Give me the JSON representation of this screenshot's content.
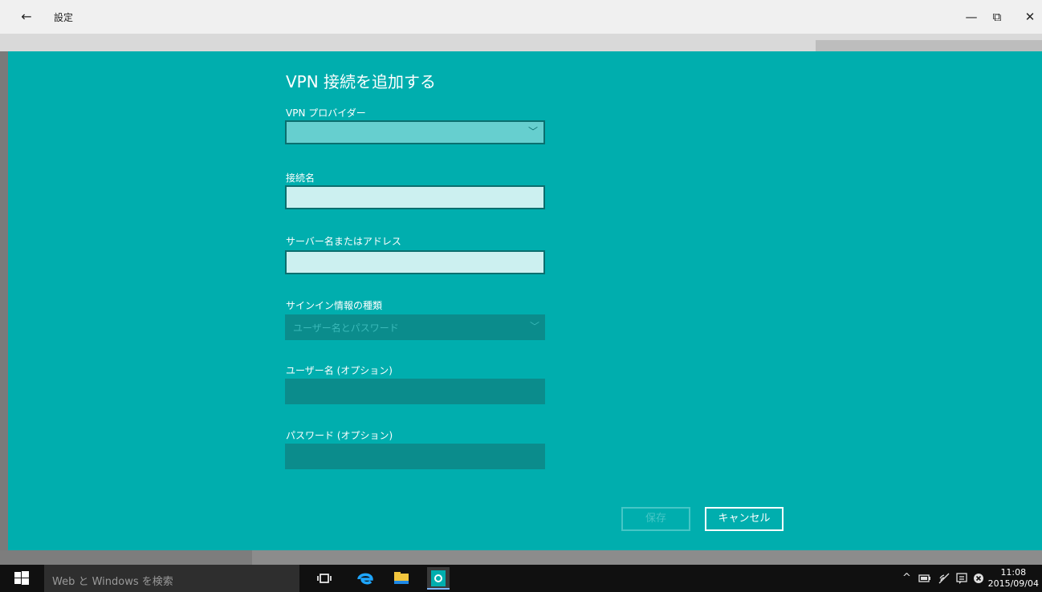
{
  "window": {
    "title": "設定",
    "back_icon": "←",
    "minimize_icon": "—",
    "restore_icon": "⧉",
    "close_icon": "✕"
  },
  "dialog": {
    "title": "VPN 接続を追加する",
    "provider": {
      "label": "VPN プロバイダー",
      "value": ""
    },
    "connection_name": {
      "label": "接続名",
      "value": ""
    },
    "server": {
      "label": "サーバー名またはアドレス",
      "value": ""
    },
    "signin_type": {
      "label": "サインイン情報の種類",
      "value": "ユーザー名とパスワード"
    },
    "username": {
      "label": "ユーザー名 (オプション)",
      "value": ""
    },
    "password": {
      "label": "パスワード (オプション)",
      "value": ""
    },
    "save_label": "保存",
    "cancel_label": "キャンセル",
    "colors": {
      "background": "#00aeae",
      "text": "#ffffff"
    }
  },
  "taskbar": {
    "search_placeholder": "Web と Windows を検索",
    "time": "11:08",
    "date": "2015/09/04"
  }
}
